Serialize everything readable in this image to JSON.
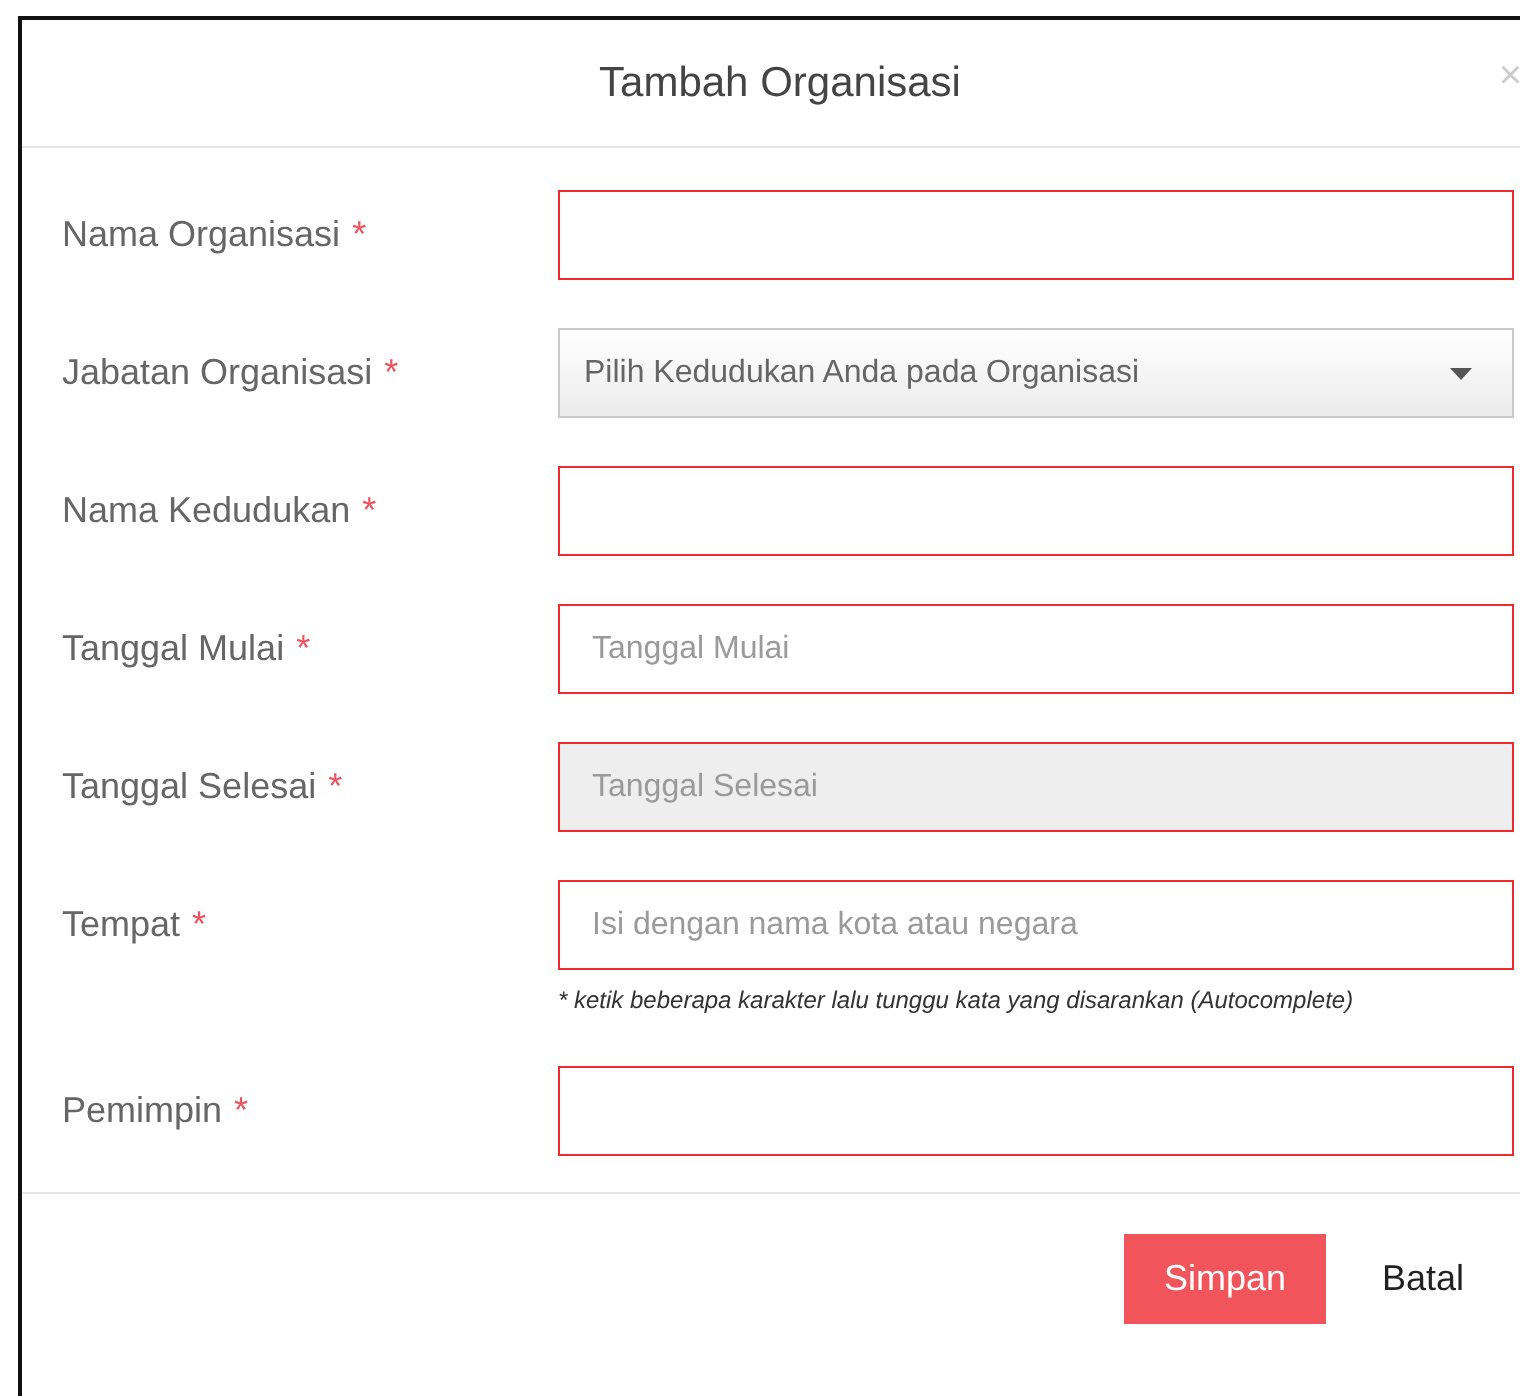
{
  "dialog": {
    "title": "Tambah Organisasi",
    "close": "×"
  },
  "fields": [
    {
      "kind": "text",
      "label": "Nama Organisasi",
      "required_mark": "*",
      "invalid": true,
      "disabled": false
    },
    {
      "kind": "select",
      "label": "Jabatan Organisasi",
      "required_mark": "*",
      "value": "Pilih Kedudukan Anda pada Organisasi",
      "invalid": false
    },
    {
      "kind": "text",
      "label": "Nama Kedudukan",
      "required_mark": "*",
      "invalid": true,
      "disabled": false
    },
    {
      "kind": "text",
      "label": "Tanggal Mulai",
      "required_mark": "*",
      "placeholder": "Tanggal Mulai",
      "invalid": true,
      "disabled": false
    },
    {
      "kind": "text",
      "label": "Tanggal Selesai",
      "required_mark": "*",
      "placeholder": "Tanggal Selesai",
      "invalid": true,
      "disabled": true
    },
    {
      "kind": "text",
      "label": "Tempat",
      "required_mark": "*",
      "placeholder": "Isi dengan nama kota atau negara",
      "hint": "* ketik beberapa karakter lalu tunggu kata yang disarankan (Autocomplete)",
      "invalid": true,
      "disabled": false
    },
    {
      "kind": "text",
      "label": "Pemimpin",
      "required_mark": "*",
      "invalid": true,
      "disabled": false
    }
  ],
  "buttons": [
    {
      "label": "Simpan",
      "kind": "primary"
    },
    {
      "label": "Batal",
      "kind": "link"
    }
  ]
}
